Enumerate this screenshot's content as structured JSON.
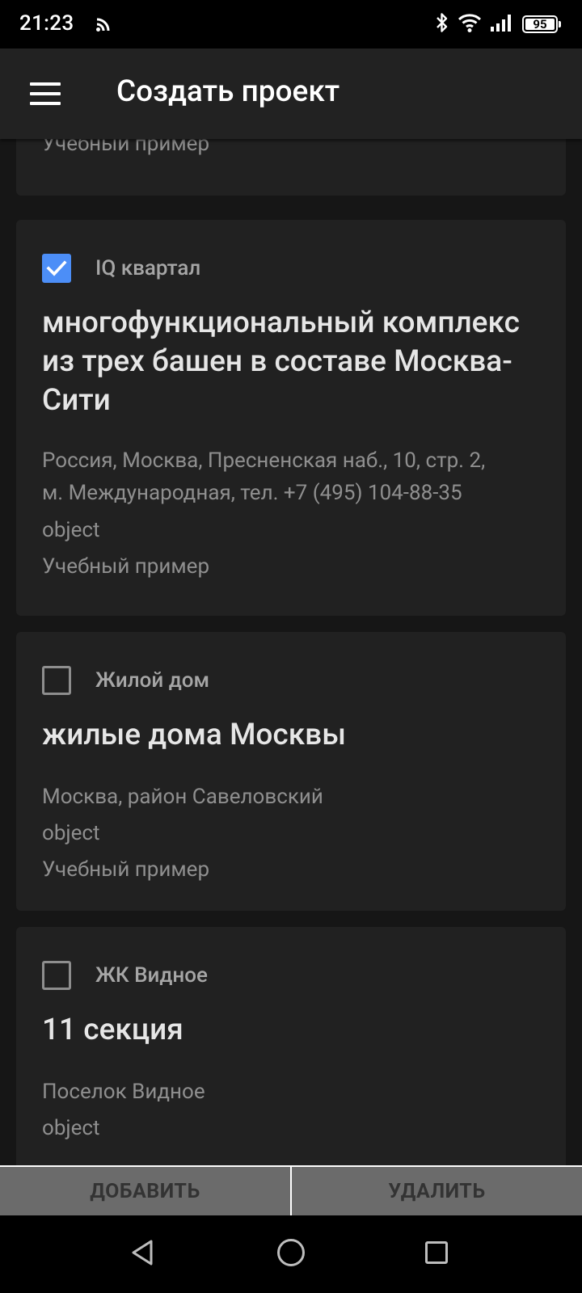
{
  "status_bar": {
    "time": "21:23",
    "battery": "95",
    "icons": [
      "cast-icon",
      "bluetooth-icon",
      "wifi-icon",
      "signal-icon",
      "battery-icon"
    ]
  },
  "app_bar": {
    "title": "Создать проект",
    "menu_icon": "hamburger-menu-icon"
  },
  "cards": [
    {
      "lines": [
        "Учебный пример"
      ]
    },
    {
      "checked": true,
      "tag": "IQ квартал",
      "heading": "многофункциональный комплекс из трех башен в составе Москва-Сити",
      "lines": [
        "Россия, Москва, Пресненская наб., 10, стр. 2,",
        "м. Международная, тел. +7 (495) 104-88-35",
        "object",
        "Учебный пример"
      ]
    },
    {
      "checked": false,
      "tag": "Жилой дом",
      "heading": "жилые дома Москвы",
      "lines": [
        "Москва, район Савеловский",
        "object",
        "Учебный пример"
      ]
    },
    {
      "checked": false,
      "tag": "ЖК Видное",
      "heading": "11 секция",
      "lines": [
        "Поселок Видное",
        "object"
      ]
    }
  ],
  "actions": {
    "add_label": "ДОБАВИТЬ",
    "delete_label": "УДАЛИТЬ"
  },
  "nav_bar": {
    "icons": [
      "back-icon",
      "home-icon",
      "recents-icon"
    ]
  },
  "colors": {
    "accent": "#4c8ef7",
    "background": "#161616",
    "card": "#212121",
    "app_bar": "#222222",
    "button": "#6b6b6b"
  }
}
